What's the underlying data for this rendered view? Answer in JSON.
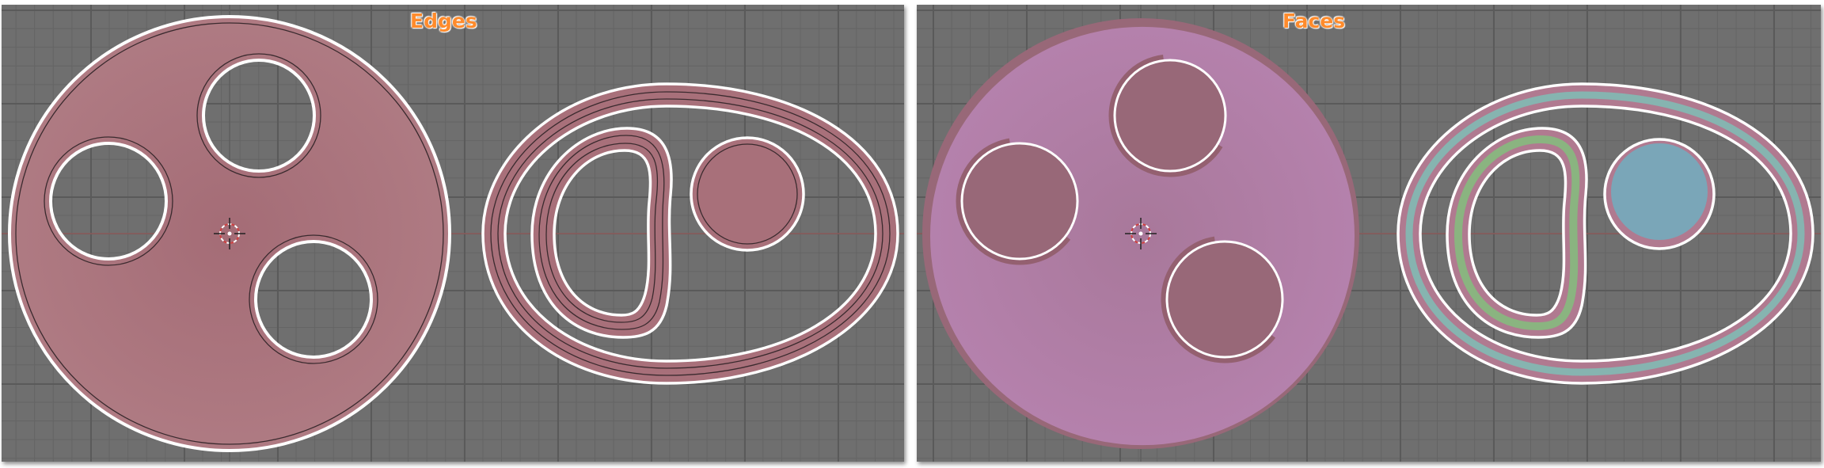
{
  "viewports": {
    "left": {
      "title": "Edges",
      "select_mode": "edge"
    },
    "right": {
      "title": "Faces",
      "select_mode": "face"
    }
  },
  "colors": {
    "viewport_bg": "#6f6f6f",
    "grid_minor": "#646464",
    "grid_major": "#5a5a5a",
    "x_axis": "#8a5a5a",
    "title_text": "#ff8b2c",
    "edge_selected_fill": "#a8707a",
    "face_selected_fill": "#b07a9e",
    "mesh_outline": "#ffffff",
    "face_green": "#8ab480",
    "face_teal": "#86b4b0",
    "face_blue": "#7aa6b8"
  },
  "icons": [
    "3d-cursor-icon"
  ]
}
